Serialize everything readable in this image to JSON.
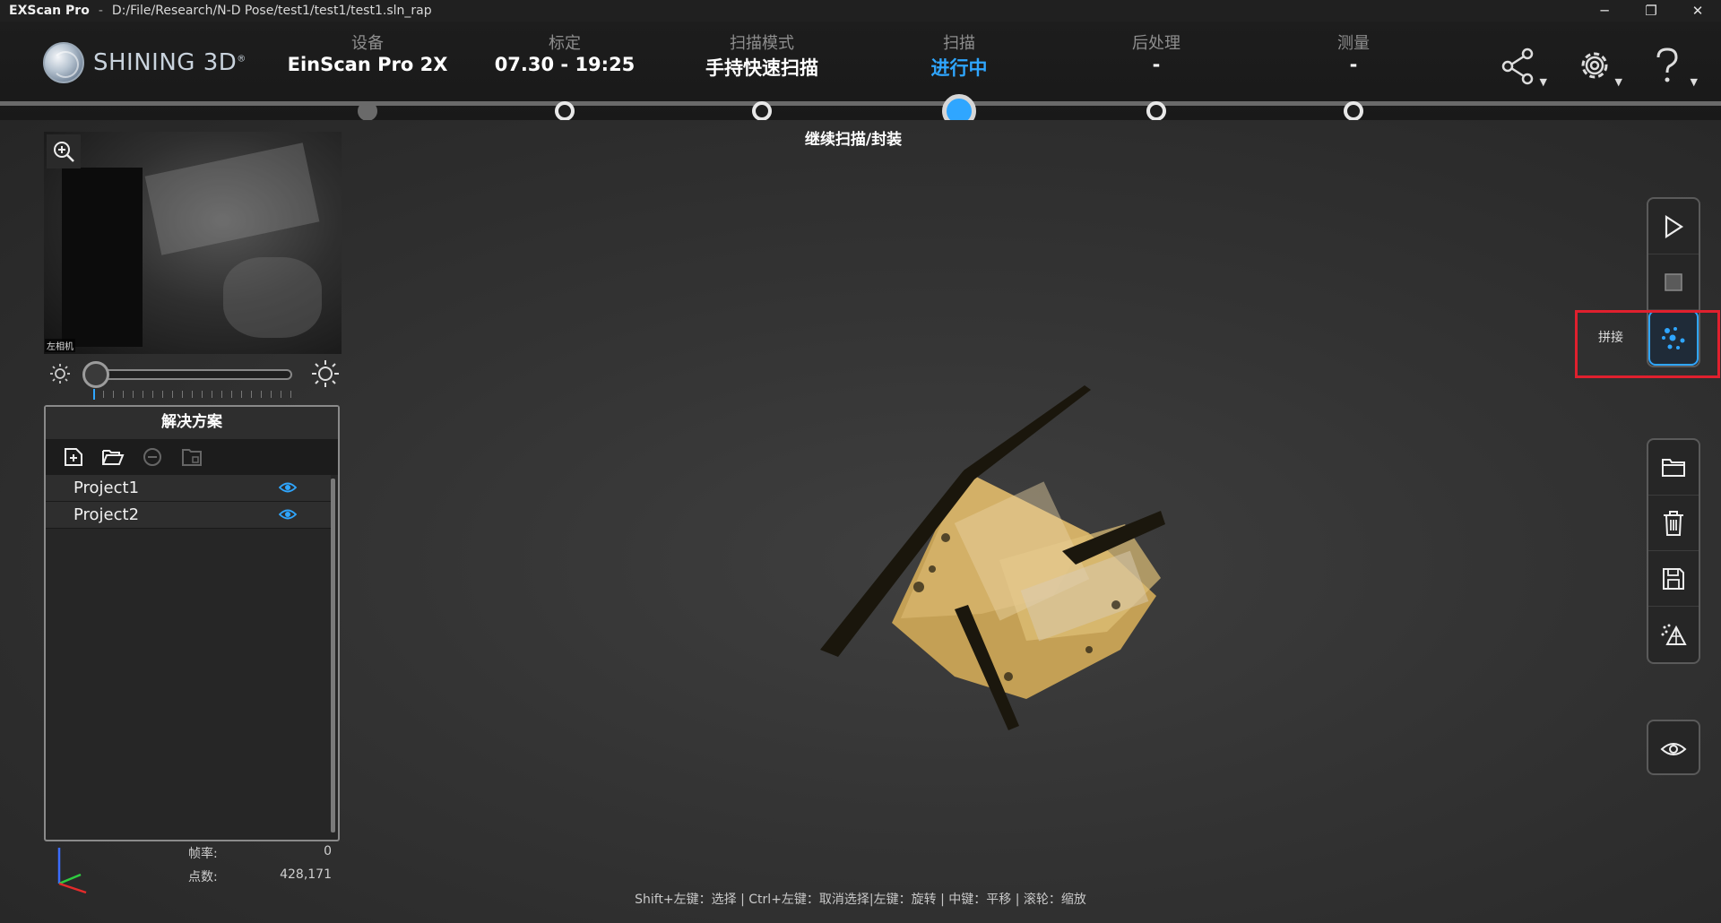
{
  "titlebar": {
    "app_name": "EXScan Pro",
    "separator": "-",
    "file_path": "D:/File/Research/N-D Pose/test1/test1/test1.sln_rap",
    "controls": [
      "─",
      "❐",
      "✕"
    ]
  },
  "header": {
    "logo_text": "SHINING 3D",
    "logo_mark": "®",
    "steps": [
      {
        "label": "设备",
        "value": "EinScan Pro 2X",
        "state": "done"
      },
      {
        "label": "标定",
        "value": "07.30 - 19:25",
        "state": "pending"
      },
      {
        "label": "扫描模式",
        "value": "手持快速扫描",
        "state": "pending"
      },
      {
        "label": "扫描",
        "value": "进行中",
        "state": "active"
      },
      {
        "label": "后处理",
        "value": "-",
        "state": "pending"
      },
      {
        "label": "测量",
        "value": "-",
        "state": "pending"
      }
    ],
    "active_sub": "继续扫描/封装",
    "icons": [
      "share-icon",
      "settings-icon",
      "help-icon"
    ],
    "accent_color": "#2fa6ff"
  },
  "camera": {
    "label": "左相机",
    "zoom_icon": "zoom-in-icon"
  },
  "brightness": {
    "level": 0.0,
    "icons": [
      "brightness-low-icon",
      "brightness-high-icon"
    ]
  },
  "solution": {
    "title": "解决方案",
    "toolbar_icons": [
      "new-project-icon",
      "open-project-icon",
      "remove-project-icon",
      "project-folder-icon"
    ],
    "projects": [
      {
        "name": "Project1",
        "visible": true
      },
      {
        "name": "Project2",
        "visible": true
      }
    ]
  },
  "stats": {
    "fps_label": "帧率:",
    "fps_value": "0",
    "points_label": "点数:",
    "points_value": "428,171"
  },
  "hint": "Shift+左键：选择 | Ctrl+左键：取消选择|左键：旋转 | 中键：平移 | 滚轮：缩放",
  "right_tools": {
    "group1": [
      "play-icon",
      "stop-icon",
      "stitch-icon"
    ],
    "stitch_label": "拼接",
    "group2": [
      "folder-icon",
      "trash-icon",
      "save-icon",
      "mesh-icon"
    ],
    "group3": [
      "eye-icon"
    ]
  }
}
